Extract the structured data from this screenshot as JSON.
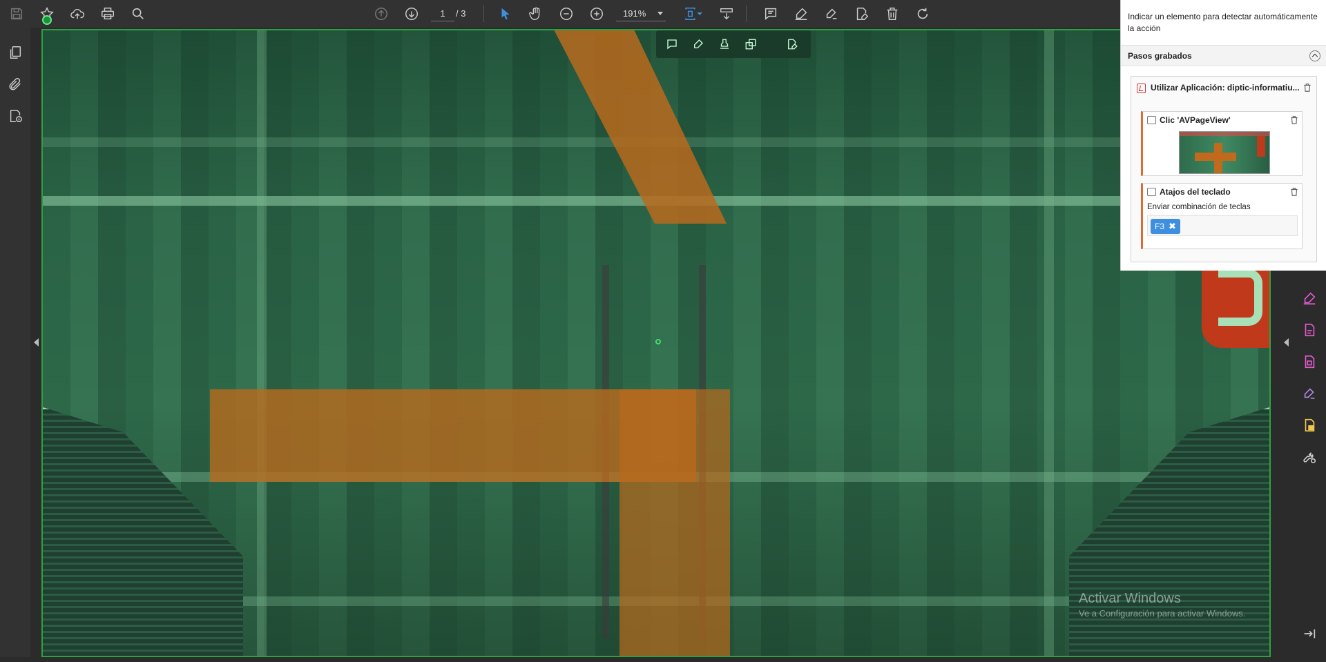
{
  "toolbar": {
    "page_current": "1",
    "page_total": "/ 3",
    "zoom": "191%"
  },
  "document": {
    "watermark_line1": "Activar Windows",
    "watermark_line2": "Ve a Configuración para activar Windows."
  },
  "panel": {
    "hint": "Indicar un elemento para detectar automáticamente la acción",
    "section_title": "Pasos grabados",
    "app_step_title": "Utilizar Aplicación: diptic-informatiu...",
    "click_step_title": "Clic 'AVPageView'",
    "shortcut_step_title": "Atajos del teclado",
    "shortcut_desc": "Enviar combinación de teclas",
    "key_chip": "F3",
    "key_chip_remove": "✖"
  },
  "colors": {
    "toolbar_bg": "#323232",
    "accent_blue": "#3f8fe0",
    "selection_green": "#2ea043",
    "step_accent": "#e36a2e"
  }
}
